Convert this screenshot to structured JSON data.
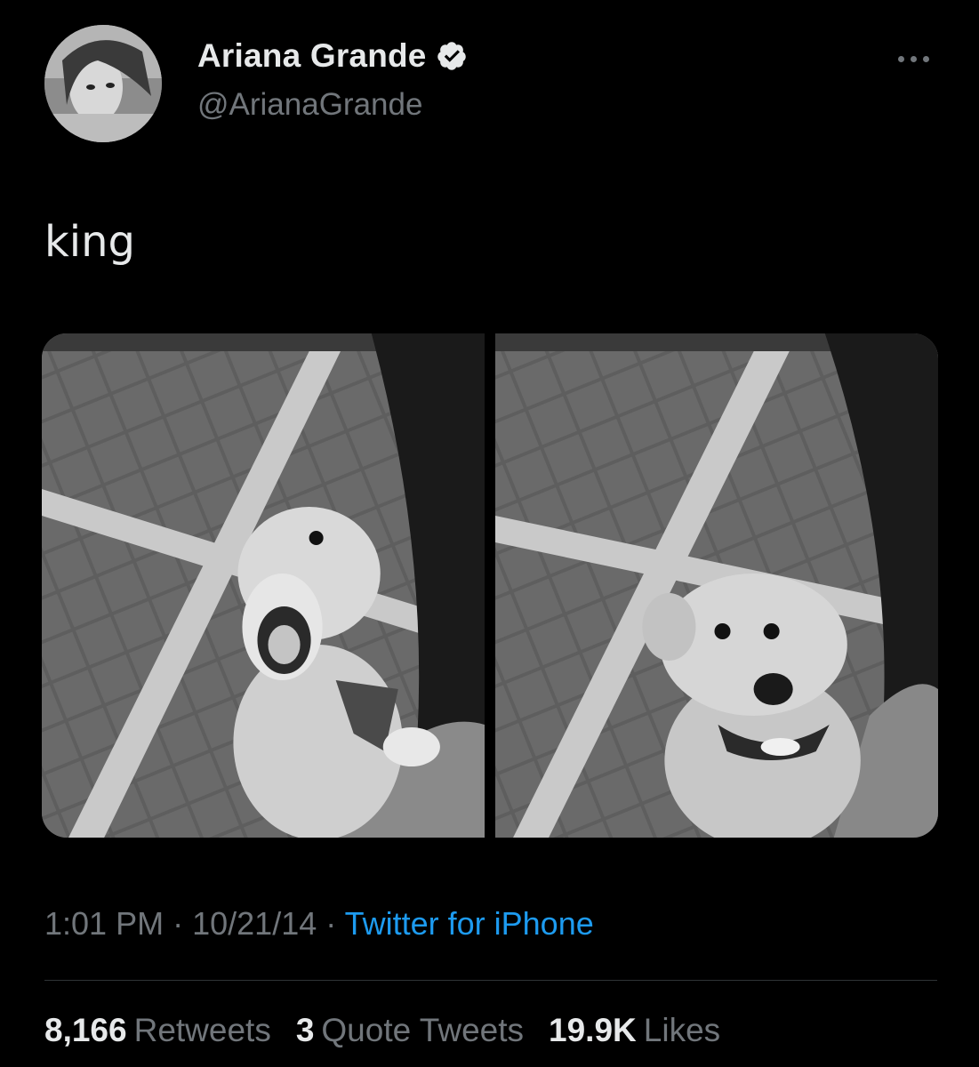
{
  "tweet": {
    "display_name": "Ariana Grande",
    "handle": "@ArianaGrande",
    "text": "king",
    "time": "1:01 PM",
    "date": "10/21/14",
    "source": "Twitter for iPhone",
    "separator": "·"
  },
  "stats": {
    "retweets_count": "8,166",
    "retweets_label": "Retweets",
    "quotes_count": "3",
    "quotes_label": "Quote Tweets",
    "likes_count": "19.9K",
    "likes_label": "Likes"
  },
  "icons": {
    "verified": "verified-badge-icon",
    "more": "more-options-icon"
  },
  "colors": {
    "background": "#000000",
    "text_primary": "#e7e9ea",
    "text_secondary": "#71767b",
    "link": "#1d9bf0",
    "divider": "#2f3336"
  }
}
